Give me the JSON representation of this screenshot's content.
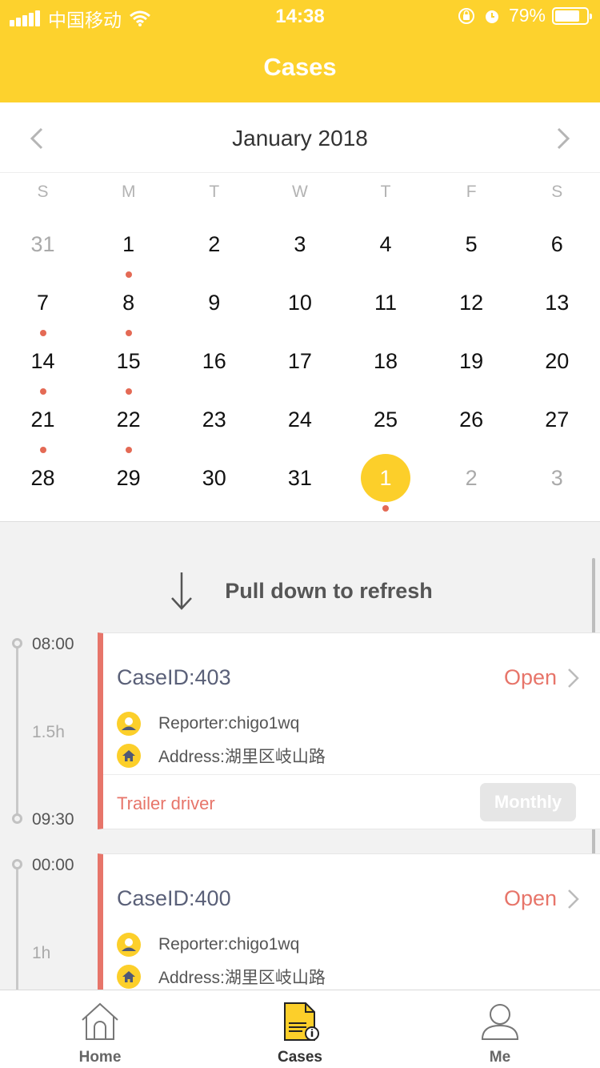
{
  "status_bar": {
    "carrier": "中国移动",
    "time": "14:38",
    "battery": "79%",
    "battery_level": 0.79
  },
  "header": {
    "title": "Cases"
  },
  "calendar": {
    "month": "January 2018",
    "weekdays": [
      "S",
      "M",
      "T",
      "W",
      "T",
      "F",
      "S"
    ],
    "weeks": [
      [
        {
          "d": "31",
          "muted": true
        },
        {
          "d": "1",
          "dot": true
        },
        {
          "d": "2"
        },
        {
          "d": "3"
        },
        {
          "d": "4"
        },
        {
          "d": "5"
        },
        {
          "d": "6"
        }
      ],
      [
        {
          "d": "7",
          "dot": true
        },
        {
          "d": "8",
          "dot": true
        },
        {
          "d": "9"
        },
        {
          "d": "10"
        },
        {
          "d": "11"
        },
        {
          "d": "12"
        },
        {
          "d": "13"
        }
      ],
      [
        {
          "d": "14",
          "dot": true
        },
        {
          "d": "15",
          "dot": true
        },
        {
          "d": "16"
        },
        {
          "d": "17"
        },
        {
          "d": "18"
        },
        {
          "d": "19"
        },
        {
          "d": "20"
        }
      ],
      [
        {
          "d": "21",
          "dot": true
        },
        {
          "d": "22",
          "dot": true
        },
        {
          "d": "23"
        },
        {
          "d": "24"
        },
        {
          "d": "25"
        },
        {
          "d": "26"
        },
        {
          "d": "27"
        }
      ],
      [
        {
          "d": "28"
        },
        {
          "d": "29"
        },
        {
          "d": "30"
        },
        {
          "d": "31"
        },
        {
          "d": "1",
          "selected": true,
          "dot": true
        },
        {
          "d": "2",
          "muted": true
        },
        {
          "d": "3",
          "muted": true
        }
      ]
    ]
  },
  "refresh": {
    "label": "Pull down to refresh"
  },
  "cases": [
    {
      "start": "08:00",
      "duration": "1.5h",
      "end": "09:30",
      "case_id": "CaseID:403",
      "status": "Open",
      "reporter": "Reporter:chigo1wq",
      "address": "Address:湖里区岐山路",
      "category": "Trailer driver",
      "tag": "Monthly"
    },
    {
      "start": "00:00",
      "duration": "1h",
      "case_id": "CaseID:400",
      "status": "Open",
      "reporter": "Reporter:chigo1wq",
      "address": "Address:湖里区岐山路"
    }
  ],
  "tabbar": {
    "home": "Home",
    "cases": "Cases",
    "me": "Me"
  },
  "colors": {
    "accent": "#fdd22d",
    "status_open": "#e7756a"
  }
}
